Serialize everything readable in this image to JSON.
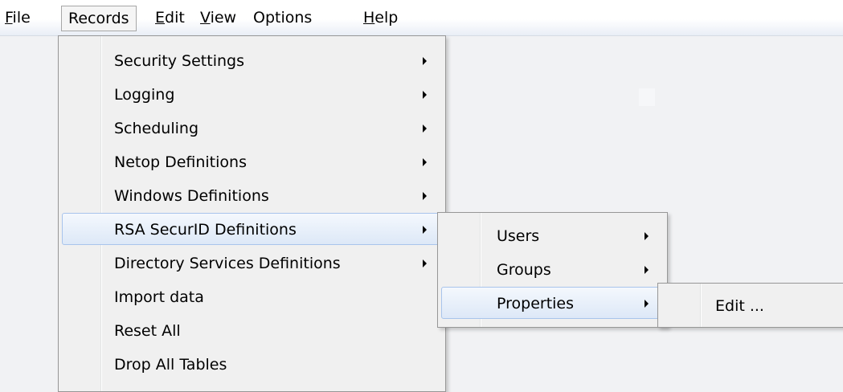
{
  "menubar": {
    "items": [
      {
        "label": "File",
        "mnemonic": "F",
        "rest": "ile"
      },
      {
        "label": "Records"
      },
      {
        "label": "Edit",
        "mnemonic": "E",
        "rest": "dit"
      },
      {
        "label": "View",
        "mnemonic": "V",
        "rest": "iew"
      },
      {
        "label": "Options"
      },
      {
        "label": "Help",
        "mnemonic": "H",
        "rest": "elp"
      }
    ]
  },
  "records_menu": {
    "items": [
      {
        "label": "Security Settings",
        "submenu": true
      },
      {
        "label": "Logging",
        "submenu": true
      },
      {
        "label": "Scheduling",
        "submenu": true
      },
      {
        "label": "Netop Definitions",
        "submenu": true
      },
      {
        "label": "Windows Definitions",
        "submenu": true
      },
      {
        "label": "RSA SecurID Definitions",
        "submenu": true,
        "highlighted": true
      },
      {
        "label": "Directory Services Definitions",
        "submenu": true
      },
      {
        "label": "Import data",
        "submenu": false
      },
      {
        "label": "Reset All",
        "submenu": false
      },
      {
        "label": "Drop All Tables",
        "submenu": false
      }
    ]
  },
  "rsa_submenu": {
    "items": [
      {
        "label": "Users",
        "submenu": true
      },
      {
        "label": "Groups",
        "submenu": true
      },
      {
        "label": "Properties",
        "submenu": true,
        "highlighted": true
      }
    ]
  },
  "properties_submenu": {
    "items": [
      {
        "label": "Edit ..."
      }
    ]
  },
  "colors": {
    "highlight_top": "#f4f8fd",
    "highlight_bottom": "#dde8f7",
    "highlight_border": "#a8c4ec",
    "menu_bg": "#f0f0f0"
  }
}
